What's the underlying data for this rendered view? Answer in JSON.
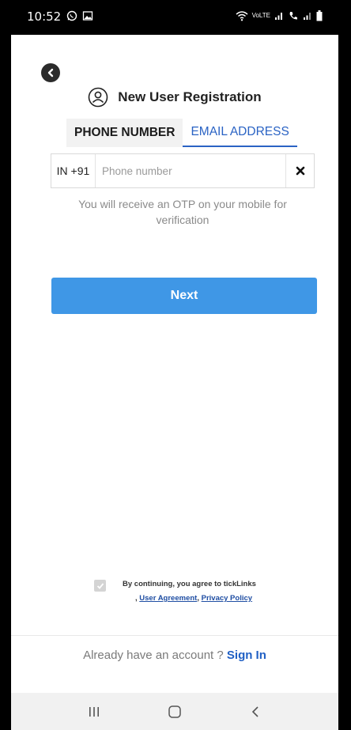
{
  "status_bar": {
    "time": "10:52",
    "left_icons": [
      "whatsapp-icon",
      "image-icon"
    ],
    "right_icons": [
      "wifi-icon",
      "volte-lte-icon",
      "signal-icon",
      "wifi-call-icon",
      "signal-2-icon",
      "battery-icon"
    ],
    "volte_label": "VoLTE"
  },
  "header": {
    "title": "New User Registration",
    "title_icon": "user-circle-icon",
    "back_icon": "back-arrow-icon"
  },
  "tabs": [
    {
      "label": "PHONE NUMBER",
      "active": true
    },
    {
      "label": "EMAIL ADDRESS",
      "active": false
    }
  ],
  "phone_input": {
    "country_code": "IN +91",
    "placeholder": "Phone number",
    "value": "",
    "clear_icon": "close-icon"
  },
  "otp_info": "You will receive an OTP on your mobile for verification",
  "next_button": "Next",
  "agreement": {
    "checked": true,
    "text": "By continuing, you agree to tickLinks",
    "prefix": ", ",
    "link1": "User Agreement",
    "separator": ", ",
    "link2": "Privacy Policy"
  },
  "signin": {
    "prompt": "Already have an account ? ",
    "link": "Sign In"
  },
  "nav_bar": {
    "items": [
      "recent-apps-icon",
      "home-icon",
      "back-icon"
    ]
  },
  "colors": {
    "primary": "#3f97e6",
    "link": "#1f5fc4",
    "tab_active_bg": "#f2f2f2"
  }
}
